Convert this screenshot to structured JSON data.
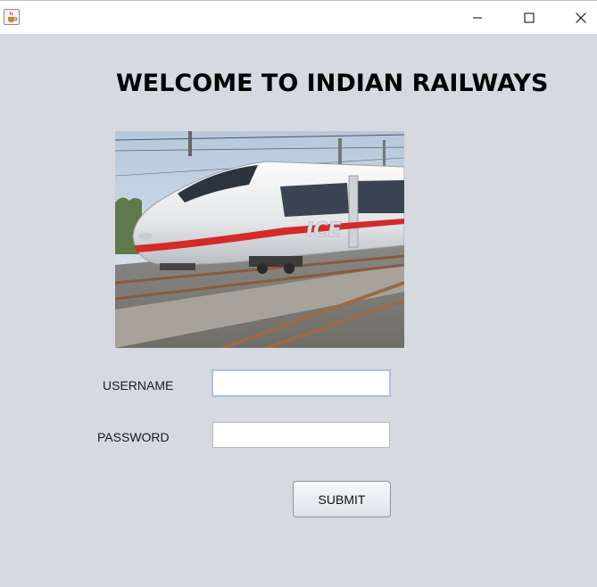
{
  "window": {
    "icon": "java-cup-icon",
    "controls": [
      "minimize-icon",
      "maximize-icon",
      "close-icon"
    ]
  },
  "main": {
    "heading": "WELCOME TO INDIAN RAILWAYS",
    "image_alt": "ICE",
    "username_label": "USERNAME",
    "username_value": "",
    "password_label": "PASSWORD",
    "password_value": "",
    "submit_label": "SUBMIT"
  },
  "colors": {
    "background": "#d6d9e0",
    "train_stripe": "#d42a2a",
    "field_focus_border": "#a9c2dd"
  }
}
